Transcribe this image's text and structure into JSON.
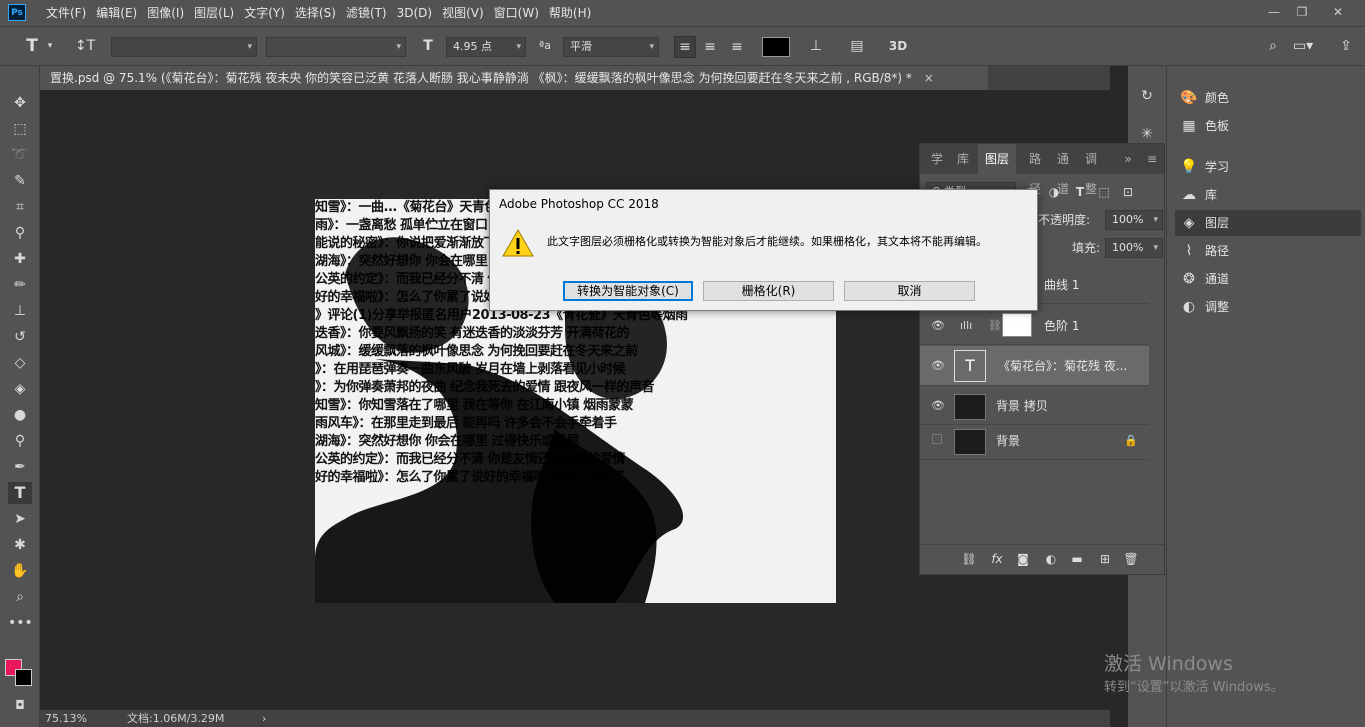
{
  "menubar": {
    "logo": "Ps",
    "items": [
      "文件(F)",
      "编辑(E)",
      "图像(I)",
      "图层(L)",
      "文字(Y)",
      "选择(S)",
      "滤镜(T)",
      "3D(D)",
      "视图(V)",
      "窗口(W)",
      "帮助(H)"
    ]
  },
  "options": {
    "font_size": "4.95 点",
    "aa_label": "ªa",
    "antialias": "平滑",
    "text_color": "#000000",
    "threed": "3D"
  },
  "document": {
    "tab_title": "置换.psd @ 75.1% (《菊花台》：菊花残 夜未央 你的笑容已泛黄 花落人断肠 我心事静静淌 《枫》：缓缓飘落的枫叶像思念 为何挽回要赶在冬天来之前 , RGB/8*) *",
    "close": "×",
    "zoom": "75.13%",
    "doc_info": "文档:1.06M/3.29M",
    "canvas_text_lines": [
      "知雪》：一曲...《菊花台》天青色等烟雨 而我在等你 炊",
      "雨》：一盏离愁 孤单伫立在窗口 我在门后假装你人还没走",
      "能说的秘密》：你说把爱渐渐放下会走更远 又何必去改变",
      "湖海》：突然好想你 你会在哪里 过得快乐或委屈 突然",
      "公英的约定》：而我已经分不清 你是友情还是错过的爱情",
      "好的幸福啦》：怎么了你累了说好的幸福呢 我懂了不说了",
      "》评论(1)分享举报匿名用户2013-08-23《青花瓷》天青色等烟雨",
      "迭香》：你要风飘扬的笑 有迷迭香的淡淡芬芳 开满荷花的",
      "风城》：缓缓飘落的枫叶像思念 为何挽回要赶在冬天来之前",
      "》：在用琵琶弹奏一曲东风破 岁月在墙上剥落看见小时候",
      "》：为你弹奏萧邦的夜曲 纪念我死去的爱情 跟夜风一样的声音",
      "知雪》：你知雪落在了哪里 我在等你 在江南小镇 烟雨蒙蒙",
      "雨风车》：在那里走到最后 能再吗 许多会不会手牵着手",
      "湖海》：突然好想你 你会在哪里 过得快乐或委屈",
      "公英的约定》：而我已经分不清 你是友情还是错过的爱情",
      "好的幸福啦》：怎么了你累了说好的幸福呢 我懂了不说了"
    ]
  },
  "dialog": {
    "title": "Adobe Photoshop CC 2018",
    "message": "此文字图层必须栅格化或转换为智能对象后才能继续。如果栅格化，其文本将不能再编辑。",
    "btn_convert": "转换为智能对象(C)",
    "btn_rasterize": "栅格化(R)",
    "btn_cancel": "取消"
  },
  "dock": {
    "items": [
      {
        "icon": "color-icon",
        "label": "颜色"
      },
      {
        "icon": "swatches-icon",
        "label": "色板"
      },
      {
        "icon": "learn-icon",
        "label": "学习"
      },
      {
        "icon": "libraries-icon",
        "label": "库"
      },
      {
        "icon": "layers-icon",
        "label": "图层"
      },
      {
        "icon": "paths-icon",
        "label": "路径"
      },
      {
        "icon": "channels-icon",
        "label": "通道"
      },
      {
        "icon": "adjustments-icon",
        "label": "调整"
      }
    ]
  },
  "layers_panel": {
    "tabs": [
      "学习",
      "库",
      "图层",
      "路径",
      "通道",
      "调整"
    ],
    "kind": "Q 类型",
    "opacity_label": "不透明度:",
    "opacity_value": "100%",
    "fill_label": "填充:",
    "fill_value": "100%",
    "layers": [
      {
        "name": "曲线 1",
        "visible": true
      },
      {
        "name": "色阶 1",
        "visible": true
      },
      {
        "name": "《菊花台》：菊花残 夜...",
        "visible": true
      },
      {
        "name": "背景 拷贝",
        "visible": true
      },
      {
        "name": "背景",
        "visible": false
      }
    ]
  },
  "watermark": {
    "line1": "激活 Windows",
    "line2": "转到“设置”以激活 Windows。"
  },
  "colors": {
    "foreground": "#e8185a",
    "background": "#000000"
  }
}
